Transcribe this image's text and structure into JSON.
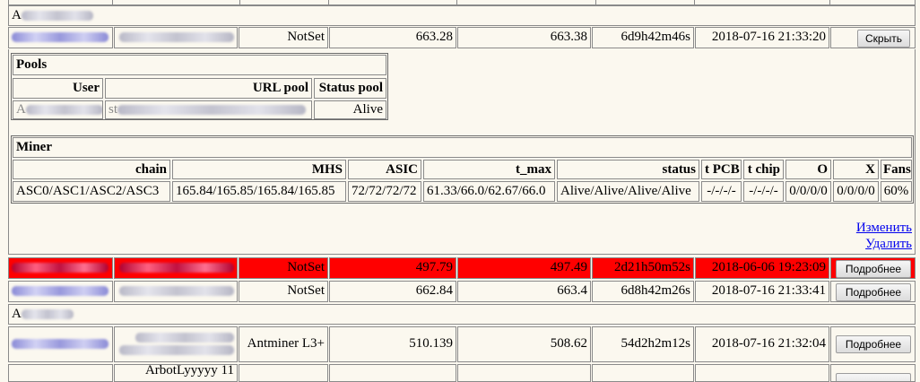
{
  "group_label_1": "A",
  "group_label_2": "A",
  "worker1": {
    "pool": "NotSet",
    "hash_avg": "663.28",
    "hash_now": "663.38",
    "uptime": "6d9h42m46s",
    "last_seen": "2018-07-16 21:33:20",
    "button": "Скрыть"
  },
  "pools": {
    "title": "Pools",
    "headers": [
      "User",
      "URL pool",
      "Status pool"
    ],
    "row": {
      "user": "A",
      "url": "st",
      "status": "Alive"
    }
  },
  "miner": {
    "title": "Miner",
    "headers": [
      "chain",
      "MHS",
      "ASIC",
      "t_max",
      "status",
      "t PCB",
      "t chip",
      "O",
      "X",
      "Fans"
    ],
    "row": [
      "ASC0/ASC1/ASC2/ASC3",
      "165.84/165.85/165.84/165.85",
      "72/72/72/72",
      "61.33/66.0/62.67/66.0",
      "Alive/Alive/Alive/Alive",
      "-/-/-/-",
      "-/-/-/-",
      "0/0/0/0",
      "0/0/0/0",
      "60%"
    ]
  },
  "links": {
    "edit": "Изменить",
    "delete": "Удалить"
  },
  "worker2": {
    "pool": "NotSet",
    "hash_avg": "497.79",
    "hash_now": "497.49",
    "uptime": "2d21h50m52s",
    "last_seen": "2018-06-06 19:23:09",
    "button": "Подробнее",
    "alert_color": "#ff0000"
  },
  "worker3": {
    "pool": "NotSet",
    "hash_avg": "662.84",
    "hash_now": "663.4",
    "uptime": "6d8h42m26s",
    "last_seen": "2018-07-16 21:33:41",
    "button": "Подробнее"
  },
  "worker4": {
    "model": "Antminer L3+",
    "hash_avg": "510.139",
    "hash_now": "508.62",
    "uptime": "54d2h2m12s",
    "last_seen": "2018-07-16 21:32:04",
    "button": "Подробнее"
  },
  "worker5": {
    "partial_name": "ArbotLyyyyy 11"
  }
}
